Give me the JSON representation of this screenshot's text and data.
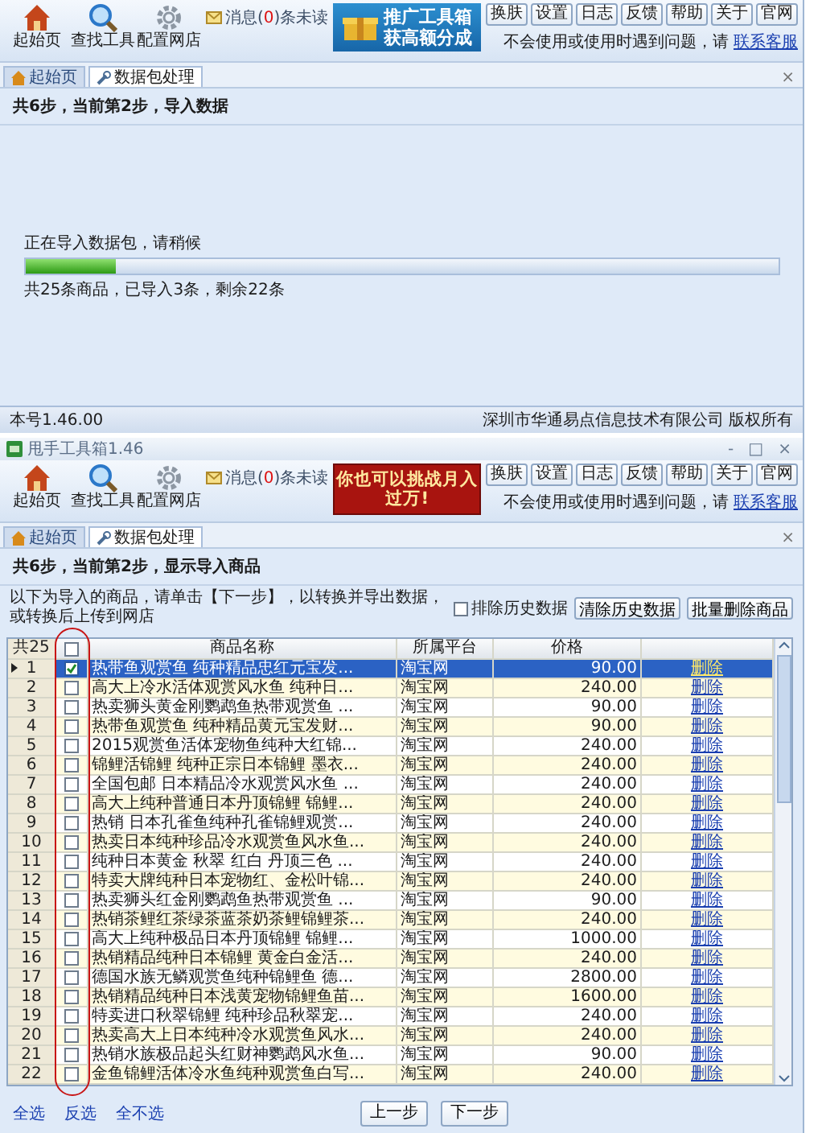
{
  "windows": [
    {
      "kind": "import_progress",
      "toolbar": {
        "nav": [
          "起始页",
          "查找工具",
          "配置网店"
        ],
        "message": {
          "prefix": "消息(",
          "count": "0",
          "suffix": ")条未读"
        },
        "banner": {
          "kind": "gift",
          "lines": [
            "推广工具箱",
            "获高额分成"
          ]
        },
        "buttons": [
          "换肤",
          "设置",
          "日志",
          "反馈",
          "帮助",
          "关于",
          "官网"
        ],
        "help": {
          "text": "不会使用或使用时遇到问题，请",
          "link": "联系客服"
        }
      },
      "tabs": [
        {
          "label": "起始页",
          "selected": false
        },
        {
          "label": "数据包处理",
          "selected": true
        }
      ],
      "tab_close": "×",
      "step": "共6步，当前第2步，导入数据",
      "progress": {
        "caption": "正在导入数据包，请稍候",
        "level": 0.12,
        "summary": "共25条商品，已导入3条，剩余22条"
      },
      "status_bar": {
        "version": "本号1.46.00",
        "copyright": "深圳市华通易点信息技术有限公司 版权所有"
      }
    },
    {
      "kind": "product_table",
      "title": "甩手工具箱1.46",
      "window_controls": [
        "-",
        "□",
        "×"
      ],
      "toolbar": {
        "nav": [
          "起始页",
          "查找工具",
          "配置网店"
        ],
        "message": {
          "prefix": "消息(",
          "count": "0",
          "suffix": ")条未读"
        },
        "banner": {
          "kind": "plain",
          "lines": [
            "你也可以挑战月入过万!"
          ]
        },
        "buttons": [
          "换肤",
          "设置",
          "日志",
          "反馈",
          "帮助",
          "关于",
          "官网"
        ],
        "help": {
          "text": "不会使用或使用时遇到问题，请",
          "link": "联系客服"
        }
      },
      "tabs": [
        {
          "label": "起始页",
          "selected": false
        },
        {
          "label": "数据包处理",
          "selected": true
        }
      ],
      "tab_close": "×",
      "step": "共6步，当前第2步，显示导入商品",
      "instructions": "以下为导入的商品，请单击【下一步】，以转换并导出数据，或转换后上传到网店",
      "exclude_history": {
        "label": "排除历史数据",
        "checked": false
      },
      "actions": [
        "清除历史数据",
        "批量删除商品"
      ],
      "table": {
        "count": "共25",
        "select_all_checked": false,
        "columns": [
          "商品名称",
          "所属平台",
          "价格"
        ],
        "rows": [
          {
            "no": "1",
            "checked": true,
            "selected": true,
            "name": "热带鱼观赏鱼 纯种精品忠红元宝发...",
            "platform": "淘宝网",
            "price": "90.00",
            "action": "删除"
          },
          {
            "no": "2",
            "checked": false,
            "selected": false,
            "name": "高大上冷水活体观赏风水鱼 纯种日...",
            "platform": "淘宝网",
            "price": "240.00",
            "action": "删除"
          },
          {
            "no": "3",
            "checked": false,
            "selected": false,
            "name": "热卖狮头黄金刚鹦鹉鱼热带观赏鱼 ...",
            "platform": "淘宝网",
            "price": "90.00",
            "action": "删除"
          },
          {
            "no": "4",
            "checked": false,
            "selected": false,
            "name": "热带鱼观赏鱼 纯种精品黄元宝发财...",
            "platform": "淘宝网",
            "price": "90.00",
            "action": "删除"
          },
          {
            "no": "5",
            "checked": false,
            "selected": false,
            "name": "2015观赏鱼活体宠物鱼纯种大红锦...",
            "platform": "淘宝网",
            "price": "240.00",
            "action": "删除"
          },
          {
            "no": "6",
            "checked": false,
            "selected": false,
            "name": "锦鲤活锦鲤 纯种正宗日本锦鲤 墨衣...",
            "platform": "淘宝网",
            "price": "240.00",
            "action": "删除"
          },
          {
            "no": "7",
            "checked": false,
            "selected": false,
            "name": "全国包邮 日本精品冷水观赏风水鱼 ...",
            "platform": "淘宝网",
            "price": "240.00",
            "action": "删除"
          },
          {
            "no": "8",
            "checked": false,
            "selected": false,
            "name": "高大上纯种普通日本丹顶锦鲤 锦鲤...",
            "platform": "淘宝网",
            "price": "240.00",
            "action": "删除"
          },
          {
            "no": "9",
            "checked": false,
            "selected": false,
            "name": "热销 日本孔雀鱼纯种孔雀锦鲤观赏...",
            "platform": "淘宝网",
            "price": "240.00",
            "action": "删除"
          },
          {
            "no": "10",
            "checked": false,
            "selected": false,
            "name": "热卖日本纯种珍品冷水观赏鱼风水鱼...",
            "platform": "淘宝网",
            "price": "240.00",
            "action": "删除"
          },
          {
            "no": "11",
            "checked": false,
            "selected": false,
            "name": "纯种日本黄金 秋翠 红白 丹顶三色 ...",
            "platform": "淘宝网",
            "price": "240.00",
            "action": "删除"
          },
          {
            "no": "12",
            "checked": false,
            "selected": false,
            "name": "特卖大牌纯种日本宠物红、金松叶锦...",
            "platform": "淘宝网",
            "price": "240.00",
            "action": "删除"
          },
          {
            "no": "13",
            "checked": false,
            "selected": false,
            "name": "热卖狮头红金刚鹦鹉鱼热带观赏鱼 ...",
            "platform": "淘宝网",
            "price": "90.00",
            "action": "删除"
          },
          {
            "no": "14",
            "checked": false,
            "selected": false,
            "name": "热销茶鲤红茶绿茶蓝茶奶茶鲤锦鲤茶...",
            "platform": "淘宝网",
            "price": "240.00",
            "action": "删除"
          },
          {
            "no": "15",
            "checked": false,
            "selected": false,
            "name": "高大上纯种极品日本丹顶锦鲤 锦鲤...",
            "platform": "淘宝网",
            "price": "1000.00",
            "action": "删除"
          },
          {
            "no": "16",
            "checked": false,
            "selected": false,
            "name": "热销精品纯种日本锦鲤 黄金白金活...",
            "platform": "淘宝网",
            "price": "240.00",
            "action": "删除"
          },
          {
            "no": "17",
            "checked": false,
            "selected": false,
            "name": "德国水族无鳞观赏鱼纯种锦鲤鱼 德...",
            "platform": "淘宝网",
            "price": "2800.00",
            "action": "删除"
          },
          {
            "no": "18",
            "checked": false,
            "selected": false,
            "name": "热销精品纯种日本浅黄宠物锦鲤鱼苗...",
            "platform": "淘宝网",
            "price": "1600.00",
            "action": "删除"
          },
          {
            "no": "19",
            "checked": false,
            "selected": false,
            "name": "特卖进口秋翠锦鲤 纯种珍品秋翠宠...",
            "platform": "淘宝网",
            "price": "240.00",
            "action": "删除"
          },
          {
            "no": "20",
            "checked": false,
            "selected": false,
            "name": "热卖高大上日本纯种冷水观赏鱼风水...",
            "platform": "淘宝网",
            "price": "240.00",
            "action": "删除"
          },
          {
            "no": "21",
            "checked": false,
            "selected": false,
            "name": "热销水族极品起头红财神鹦鹉风水鱼...",
            "platform": "淘宝网",
            "price": "90.00",
            "action": "删除"
          },
          {
            "no": "22",
            "checked": false,
            "selected": false,
            "name": "金鱼锦鲤活体冷水鱼纯种观赏鱼白写...",
            "platform": "淘宝网",
            "price": "240.00",
            "action": "删除"
          }
        ]
      },
      "footer_links": [
        "全选",
        "反选",
        "全不选"
      ],
      "nav_buttons": [
        "上一步",
        "下一步"
      ]
    }
  ]
}
